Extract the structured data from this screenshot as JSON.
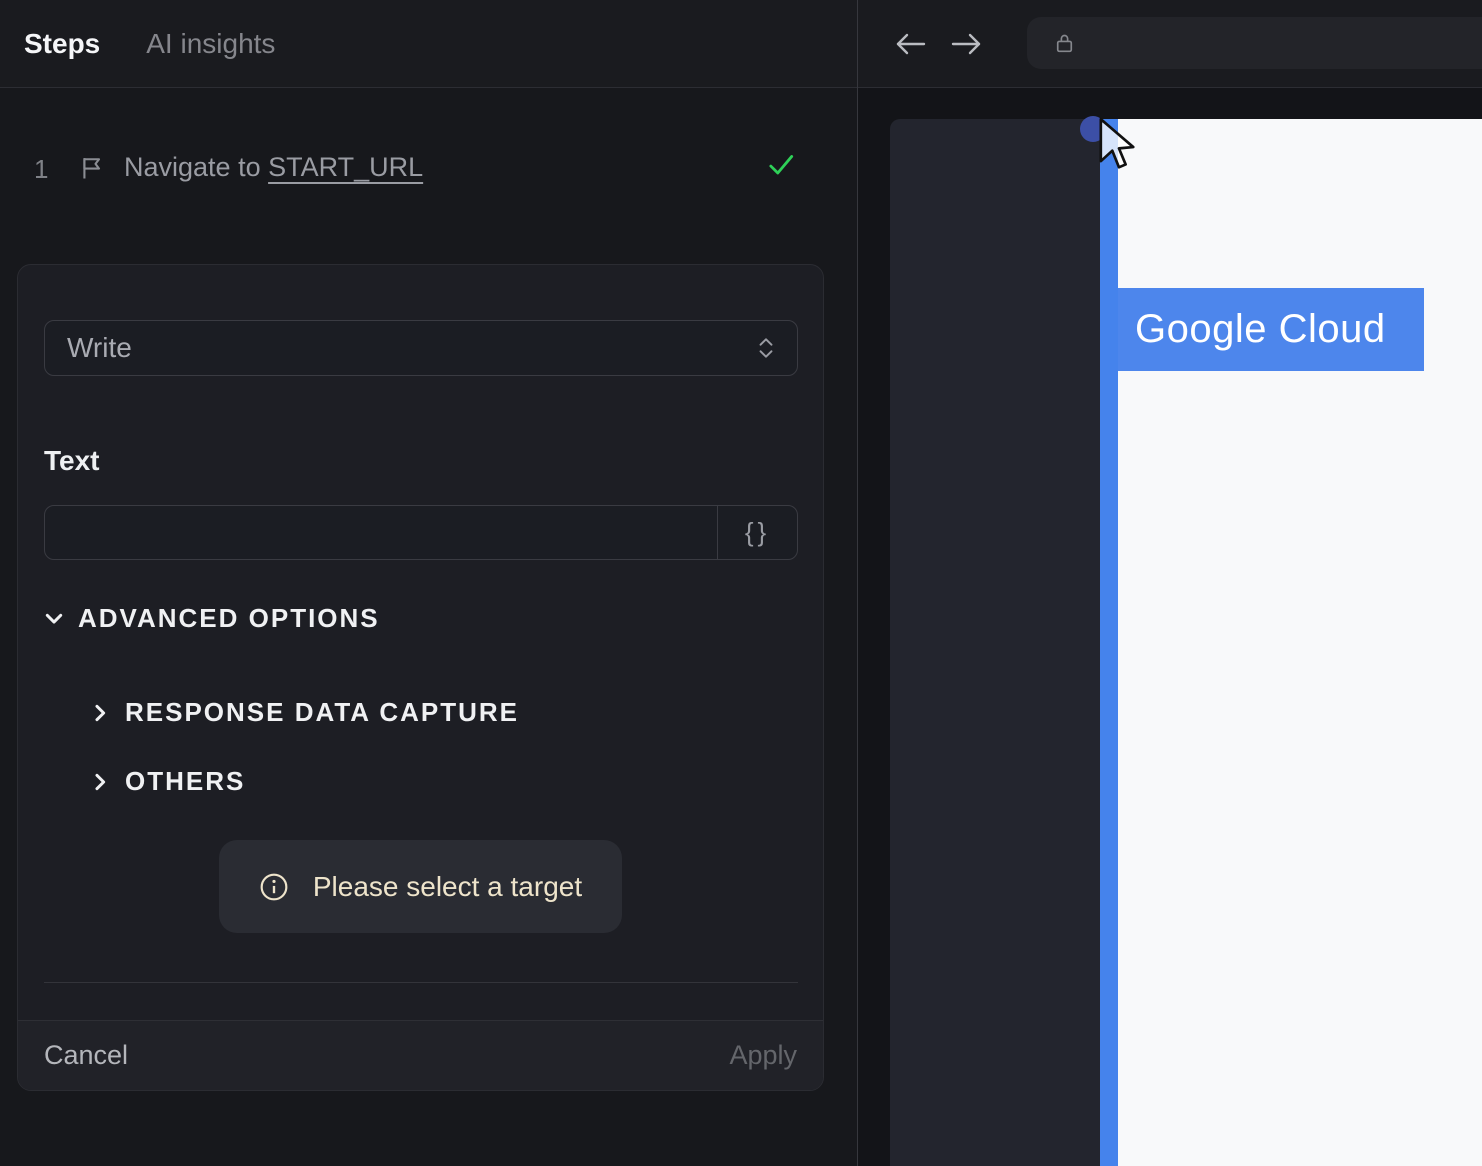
{
  "left_panel": {
    "tabs": [
      {
        "label": "Steps",
        "active": true
      },
      {
        "label": "AI insights",
        "active": false
      }
    ],
    "step": {
      "number": "1",
      "action": "Navigate to ",
      "target": "START_URL",
      "status_icon": "check"
    },
    "editor": {
      "action_select": {
        "value": "Write"
      },
      "text_label": "Text",
      "text_value": "",
      "text_placeholder": "",
      "variable_button_label": "{}",
      "advanced": {
        "label": "ADVANCED OPTIONS",
        "items": [
          {
            "label": "RESPONSE DATA CAPTURE"
          },
          {
            "label": "OTHERS"
          }
        ]
      },
      "notice": {
        "text": "Please select a target"
      },
      "footer": {
        "cancel_label": "Cancel",
        "apply_label": "Apply",
        "apply_enabled": false
      }
    }
  },
  "browser": {
    "nav": {
      "address_value": ""
    },
    "page": {
      "brand_text": "Google Cloud"
    }
  },
  "colors": {
    "accent_blue": "#4583ec",
    "highlight_blue": "#4d86ec",
    "success_green": "#2ed158",
    "notice_cream": "#eee4cb",
    "indigo_blob": "#3c4fa6",
    "page_white": "#f8f9fa"
  }
}
